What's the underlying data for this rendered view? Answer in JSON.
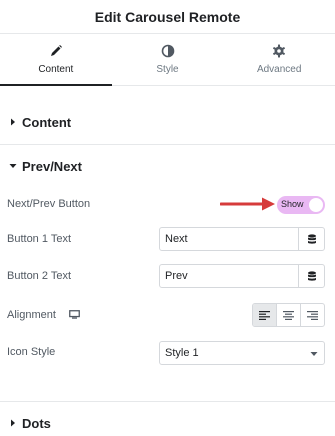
{
  "header": {
    "title": "Edit Carousel Remote"
  },
  "tabs": [
    {
      "label": "Content",
      "icon": "pencil-icon",
      "active": true
    },
    {
      "label": "Style",
      "icon": "half-circle-icon",
      "active": false
    },
    {
      "label": "Advanced",
      "icon": "gear-icon",
      "active": false
    }
  ],
  "sections": {
    "content": {
      "title": "Content",
      "expanded": false
    },
    "prev_next": {
      "title": "Prev/Next",
      "expanded": true
    },
    "dots": {
      "title": "Dots",
      "expanded": false
    }
  },
  "controls": {
    "nav_button": {
      "label": "Next/Prev Button",
      "toggle_text": "Show",
      "on": true
    },
    "button1": {
      "label": "Button 1 Text",
      "value": "Next"
    },
    "button2": {
      "label": "Button 2 Text",
      "value": "Prev"
    },
    "alignment": {
      "label": "Alignment",
      "device_icon": "desktop-icon",
      "options": [
        "left",
        "center",
        "right"
      ],
      "selected": "left"
    },
    "icon_style": {
      "label": "Icon Style",
      "value": "Style 1"
    }
  },
  "colors": {
    "accent_toggle": "#e9b8f3",
    "annotation_arrow": "#d63b3b"
  }
}
